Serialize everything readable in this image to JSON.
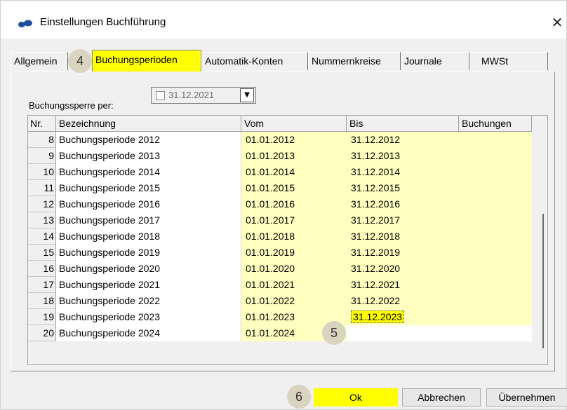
{
  "window": {
    "title": "Einstellungen Buchführung",
    "icon": "app-icon",
    "close_glyph": "✕"
  },
  "tabs": [
    {
      "label": "Allgemein"
    },
    {
      "label": "Buchungsperioden",
      "active": true
    },
    {
      "label": "Automatik-Konten"
    },
    {
      "label": "Nummernkreise"
    },
    {
      "label": "Journale"
    },
    {
      "label": "MWSt"
    }
  ],
  "badges": {
    "tab": "4",
    "cell": "5",
    "ok": "6"
  },
  "sperre": {
    "label": "Buchungssperre per:",
    "date": "31.12.2021",
    "checked": false,
    "dropdown_glyph": "▼"
  },
  "table": {
    "headers": {
      "nr": "Nr.",
      "bez": "Bezeichnung",
      "vom": "Vom",
      "bis": "Bis",
      "buch": "Buchungen"
    },
    "rows": [
      {
        "nr": "8",
        "bez": "Buchungsperiode 2012",
        "vom": "01.01.2012",
        "bis": "31.12.2012"
      },
      {
        "nr": "9",
        "bez": "Buchungsperiode 2013",
        "vom": "01.01.2013",
        "bis": "31.12.2013"
      },
      {
        "nr": "10",
        "bez": "Buchungsperiode 2014",
        "vom": "01.01.2014",
        "bis": "31.12.2014"
      },
      {
        "nr": "11",
        "bez": "Buchungsperiode 2015",
        "vom": "01.01.2015",
        "bis": "31.12.2015"
      },
      {
        "nr": "12",
        "bez": "Buchungsperiode 2016",
        "vom": "01.01.2016",
        "bis": "31.12.2016"
      },
      {
        "nr": "13",
        "bez": "Buchungsperiode 2017",
        "vom": "01.01.2017",
        "bis": "31.12.2017"
      },
      {
        "nr": "14",
        "bez": "Buchungsperiode 2018",
        "vom": "01.01.2018",
        "bis": "31.12.2018"
      },
      {
        "nr": "15",
        "bez": "Buchungsperiode 2019",
        "vom": "01.01.2019",
        "bis": "31.12.2019"
      },
      {
        "nr": "16",
        "bez": "Buchungsperiode 2020",
        "vom": "01.01.2020",
        "bis": "31.12.2020"
      },
      {
        "nr": "17",
        "bez": "Buchungsperiode 2021",
        "vom": "01.01.2021",
        "bis": "31.12.2021"
      },
      {
        "nr": "18",
        "bez": "Buchungsperiode 2022",
        "vom": "01.01.2022",
        "bis": "31.12.2022"
      },
      {
        "nr": "19",
        "bez": "Buchungsperiode 2023",
        "vom": "01.01.2023",
        "bis": "31.12.2023",
        "selected": true
      },
      {
        "nr": "20",
        "bez": "Buchungsperiode 2024",
        "vom": "01.01.2024",
        "bis": ""
      }
    ]
  },
  "buttons": {
    "ok": "Ok",
    "cancel": "Abbrechen",
    "apply": "Übernehmen"
  },
  "colors": {
    "highlight": "#ffff00",
    "editable_cell": "#ffffc0",
    "badge": "#d9d4c0"
  }
}
